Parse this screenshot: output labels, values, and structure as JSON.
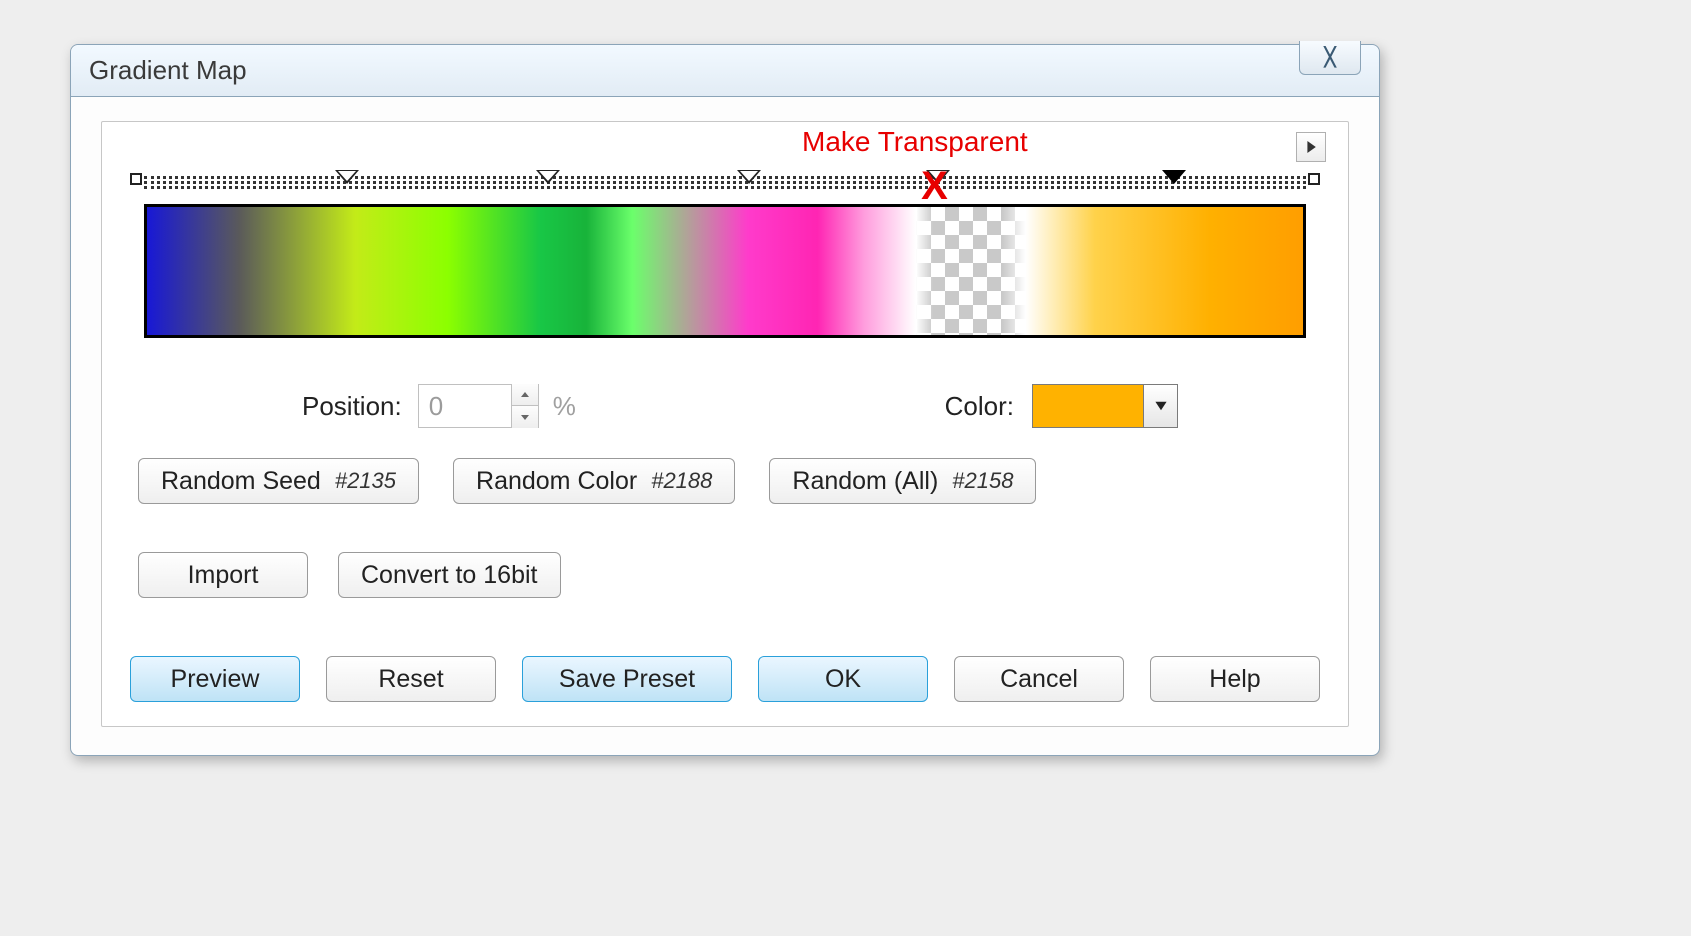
{
  "title": "Gradient Map",
  "annotation": "Make Transparent",
  "flyout_icon": "triangle-right",
  "opacity_stops_pct": [
    18,
    35,
    52,
    68,
    88
  ],
  "opacity_stop_filled_index": 4,
  "annotation_x_on_stop_index": 3,
  "controls": {
    "position_label": "Position:",
    "position_value": "0",
    "position_unit": "%",
    "color_label": "Color:",
    "color_value": "#ffb200"
  },
  "random_buttons": {
    "seed": {
      "label": "Random Seed",
      "id": "#2135"
    },
    "color": {
      "label": "Random Color",
      "id": "#2188"
    },
    "all": {
      "label": "Random  (All)",
      "id": "#2158"
    }
  },
  "action_buttons": {
    "import": "Import",
    "convert": "Convert to 16bit"
  },
  "footer_buttons": {
    "preview": "Preview",
    "reset": "Reset",
    "save_preset": "Save Preset",
    "ok": "OK",
    "cancel": "Cancel",
    "help": "Help"
  }
}
